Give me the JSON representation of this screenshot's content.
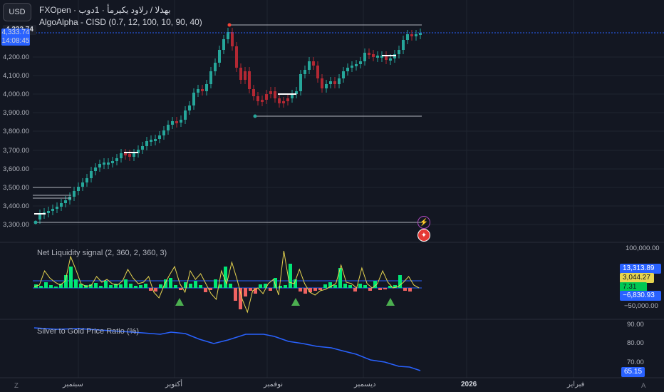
{
  "corner": {
    "label": "USD"
  },
  "header": {
    "symbol_line": "FXOpen · بهذلا / رلاود يكيرمأ · 1دوب",
    "indicator": "AlgoAlpha - CISD (0.7, 12, 100, 10, 90, 40)"
  },
  "price_panel": {
    "price_tag": "4,333.74",
    "live_price": "4,333.74",
    "countdown": "14:08:45",
    "axis_labels": [
      "4,200.00",
      "4,100.00",
      "4,000.00",
      "3,900.00",
      "3,800.00",
      "3,700.00",
      "3,600.00",
      "3,500.00",
      "3,400.00",
      "3,300.00"
    ]
  },
  "liquidity_panel": {
    "title": "Net Liquidity signal (2, 360, 2, 360, 3)",
    "axis_top": "100,000.00",
    "axis_bottom": "−50,000.00",
    "tags": [
      "13,313.89",
      "3,044.27",
      "7.31",
      "−6,830.93"
    ]
  },
  "ratio_panel": {
    "title": "Silver to Gold Price Ratio (%)",
    "axis_labels": [
      "90.00",
      "80.00",
      "70.00"
    ],
    "value_tag": "65.15"
  },
  "time_axis": {
    "labels": [
      "سبتمبر",
      "أكتوبر",
      "نوفمبر",
      "ديسمبر",
      "2026",
      "فبراير"
    ]
  },
  "colors": {
    "bg": "#131722",
    "up": "#26a69a",
    "down": "#b22833",
    "blue": "#2962ff",
    "yellow": "#e6d44f",
    "green_bar": "#00e676",
    "red_bar": "#f06262"
  }
}
